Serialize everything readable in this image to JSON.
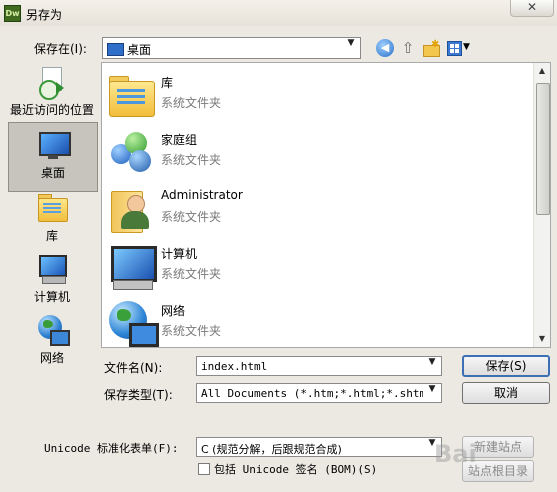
{
  "window": {
    "app_icon_text": "Dw",
    "title": "另存为",
    "close_symbol": "✕"
  },
  "save_in": {
    "label": "保存在(I):",
    "value": "桌面"
  },
  "places": [
    {
      "label": "最近访问的位置"
    },
    {
      "label": "桌面"
    },
    {
      "label": "库"
    },
    {
      "label": "计算机"
    },
    {
      "label": "网络"
    }
  ],
  "files": [
    {
      "name": "库",
      "type": "系统文件夹"
    },
    {
      "name": "家庭组",
      "type": "系统文件夹"
    },
    {
      "name": "Administrator",
      "type": "系统文件夹"
    },
    {
      "name": "计算机",
      "type": "系统文件夹"
    },
    {
      "name": "网络",
      "type": "系统文件夹"
    }
  ],
  "form": {
    "filename_label": "文件名(N):",
    "filename_value": "index.html",
    "filetype_label": "保存类型(T):",
    "filetype_value": "All Documents (*.htm;*.html;*.shtm;*.",
    "unicode_label": "Unicode 标准化表单(F):",
    "unicode_value": "C (规范分解，后跟规范合成)",
    "bom_label": "包括 Unicode 签名 (BOM)(S)"
  },
  "buttons": {
    "save": "保存(S)",
    "cancel": "取消",
    "new_site": "新建站点",
    "site_root": "站点根目录"
  },
  "watermark": "Bai"
}
